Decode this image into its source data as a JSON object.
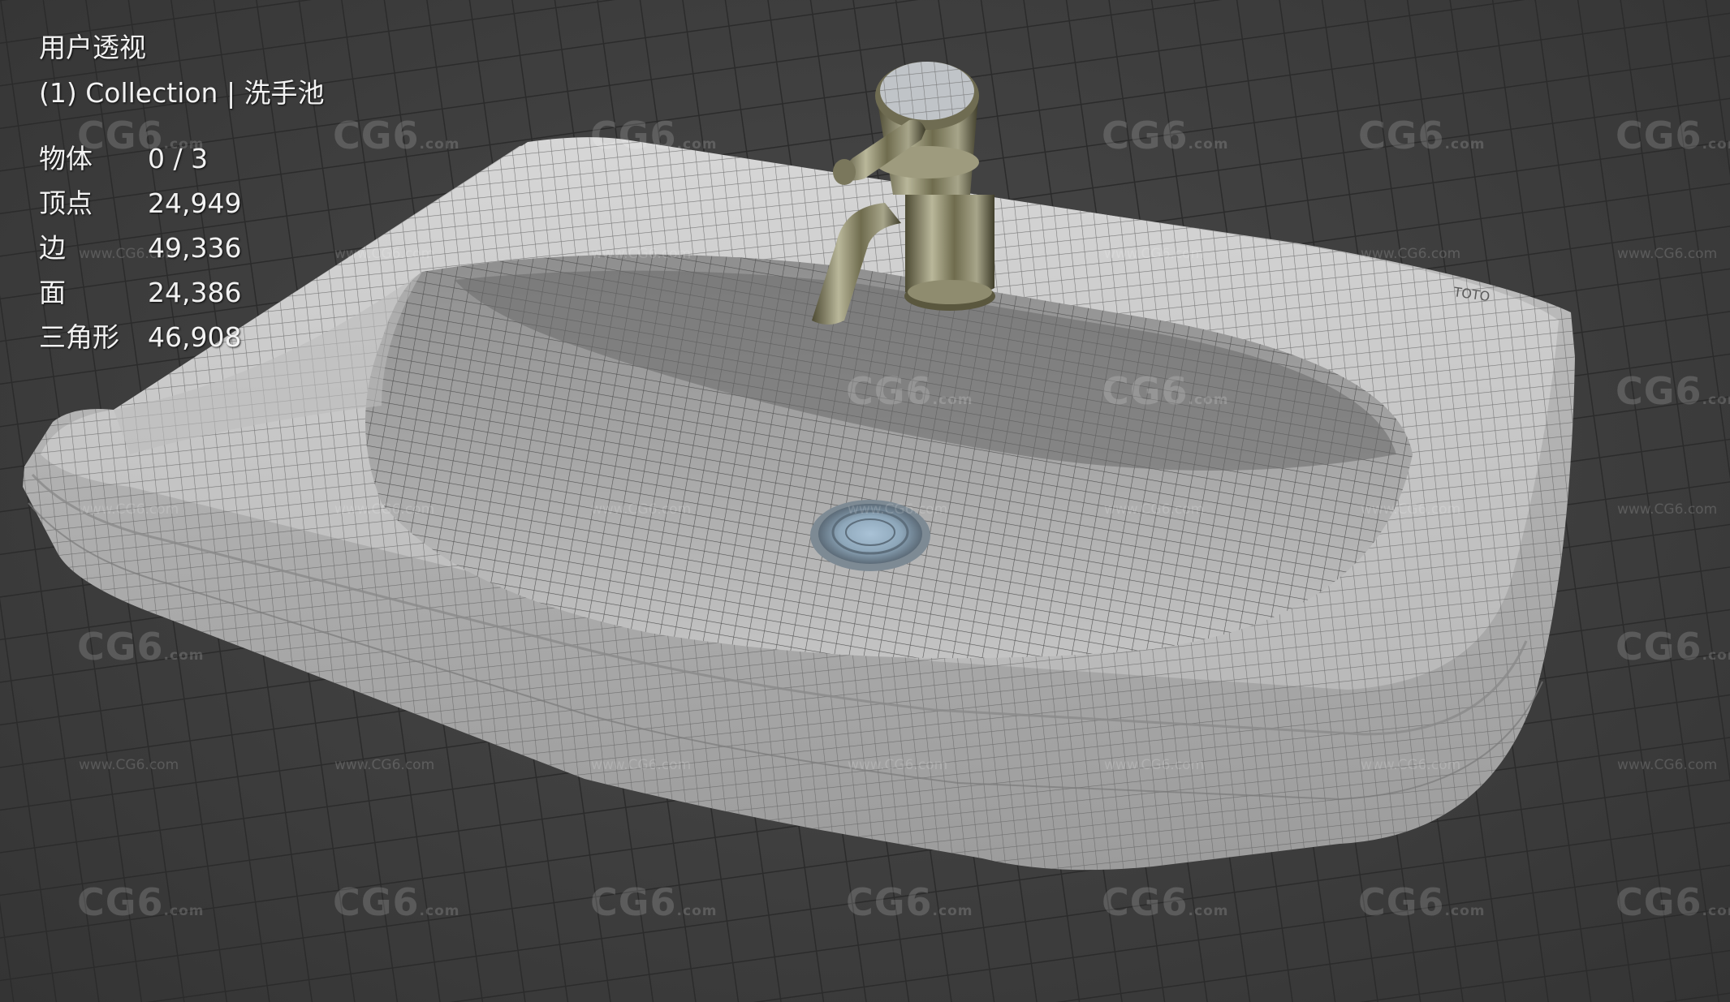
{
  "viewport": {
    "view_name": "用户透视",
    "collection_label": "(1) Collection | 洗手池"
  },
  "stats": [
    {
      "label": "物体",
      "value": "0 / 3"
    },
    {
      "label": "顶点",
      "value": "24,949"
    },
    {
      "label": "边",
      "value": "49,336"
    },
    {
      "label": "面",
      "value": "24,386"
    },
    {
      "label": "三角形",
      "value": "46,908"
    }
  ],
  "model": {
    "brand_mark": "TOTO"
  },
  "watermark": {
    "logo": "CG6",
    "logo_suffix": ".com",
    "url": "www.CG6.com"
  },
  "colors": {
    "background": "#3e3e3e",
    "grid_line": "#2a2a2a",
    "porcelain": "#c9c9c9",
    "wire": "#555555",
    "chrome": "#8a8a6a",
    "overlay_text": "#f2f2f2"
  }
}
